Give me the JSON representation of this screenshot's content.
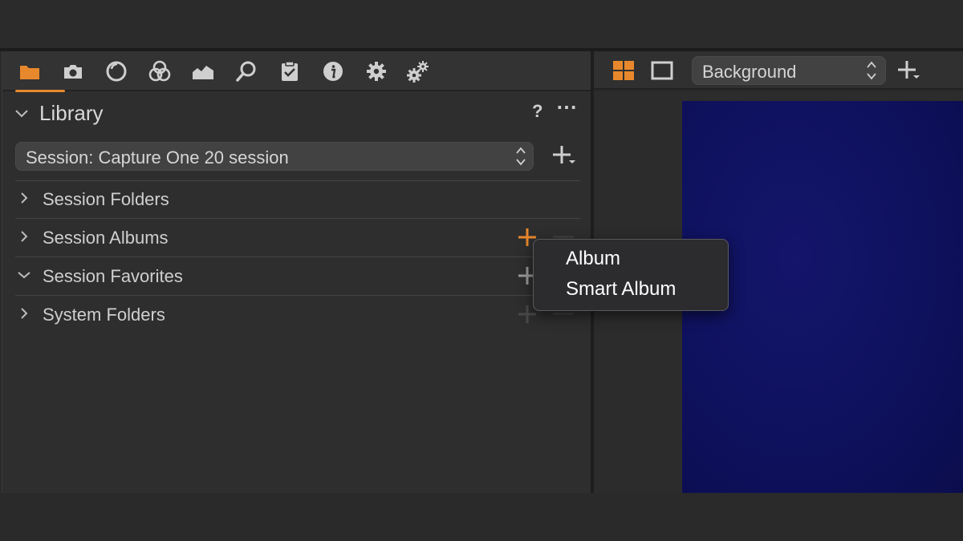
{
  "library": {
    "title": "Library",
    "help": "?",
    "more": "⋯",
    "session_select": "Session: Capture One 20 session",
    "rows": [
      {
        "label": "Session Folders",
        "expanded": false
      },
      {
        "label": "Session Albums",
        "expanded": false
      },
      {
        "label": "Session Favorites",
        "expanded": true
      },
      {
        "label": "System Folders",
        "expanded": false
      }
    ]
  },
  "tool_tabs": [
    "library-icon",
    "camera-icon",
    "lens-icon",
    "color-icon",
    "exposure-icon",
    "details-icon",
    "adjustments-icon",
    "metadata-icon",
    "output-icon",
    "batch-icon"
  ],
  "viewer": {
    "background_select": "Background"
  },
  "popup_menu": {
    "items": [
      "Album",
      "Smart Album"
    ]
  },
  "colors": {
    "accent": "#e8882c",
    "panel": "#2e2e2e",
    "image": "#10125e"
  }
}
